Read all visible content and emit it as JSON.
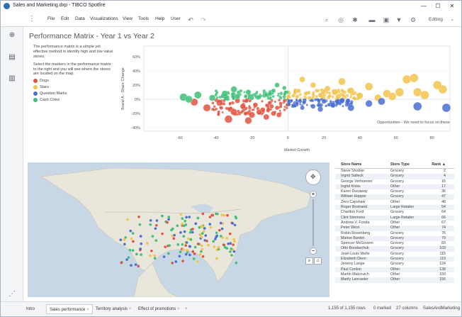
{
  "window": {
    "title": "Sales and Marketing.dxp - TIBCO Spotfire",
    "minimize": "—",
    "maximize": "☐",
    "close": "✕"
  },
  "menu": [
    "File",
    "Edit",
    "Data",
    "Visualizations",
    "View",
    "Tools",
    "Help",
    "User"
  ],
  "mode_label": "Editing",
  "page": {
    "title": "Performance Matrix - Year 1 vs Year 2",
    "description_1": "The performance matrix is a simple yet effective method to identify high and low value stores.",
    "description_2": "Select the markers in the performance matrix to the right and you will see where the stores are located on the map."
  },
  "legend": [
    {
      "label": "Dogs",
      "color": "#e0533f"
    },
    {
      "label": "Stars",
      "color": "#f2c34d"
    },
    {
      "label": "Question Marks",
      "color": "#4a6fd0"
    },
    {
      "label": "Cash Cows",
      "color": "#3fbf77"
    }
  ],
  "chart_data": {
    "type": "scatter",
    "xlabel": "Market Growth",
    "ylabel": "Brand A - Share Change",
    "x_ticks": [
      "-60",
      "-40",
      "-20",
      "0",
      "20",
      "40",
      "60",
      "80"
    ],
    "y_ticks": [
      "60%",
      "40%",
      "20%",
      "0%",
      "-20%",
      "-40%"
    ],
    "xlim": [
      -80,
      90
    ],
    "ylim": [
      -45,
      75
    ],
    "annotation": "Opportunities - We need to focus on these",
    "series": [
      {
        "name": "Dogs",
        "color": "#e0533f",
        "points": [
          [
            -45,
            -12
          ],
          [
            -38,
            -5
          ],
          [
            -30,
            -18
          ],
          [
            -25,
            -10
          ],
          [
            -20,
            -22
          ],
          [
            -18,
            -8
          ],
          [
            -14,
            -15
          ],
          [
            -10,
            -5
          ],
          [
            -8,
            -20
          ],
          [
            -6,
            -12
          ],
          [
            -4,
            -6
          ],
          [
            -2,
            -2
          ],
          [
            -33,
            -28
          ],
          [
            -52,
            -4
          ],
          [
            -22,
            -30
          ],
          [
            -12,
            -25
          ],
          [
            -28,
            -2
          ],
          [
            -16,
            -18
          ],
          [
            -9,
            -10
          ],
          [
            -5,
            -22
          ]
        ]
      },
      {
        "name": "Stars",
        "color": "#f2c34d",
        "points": [
          [
            3,
            5
          ],
          [
            6,
            12
          ],
          [
            10,
            8
          ],
          [
            14,
            20
          ],
          [
            18,
            6
          ],
          [
            22,
            15
          ],
          [
            26,
            10
          ],
          [
            30,
            25
          ],
          [
            35,
            12
          ],
          [
            40,
            5
          ],
          [
            45,
            18
          ],
          [
            55,
            8
          ],
          [
            58,
            4
          ],
          [
            62,
            10
          ],
          [
            66,
            28
          ],
          [
            70,
            30
          ],
          [
            72,
            10
          ],
          [
            76,
            6
          ],
          [
            86,
            14
          ],
          [
            83,
            20
          ],
          [
            8,
            28
          ],
          [
            12,
            2
          ],
          [
            28,
            4
          ],
          [
            50,
            2
          ]
        ]
      },
      {
        "name": "Question Marks",
        "color": "#4a6fd0",
        "points": [
          [
            2,
            -2
          ],
          [
            5,
            -6
          ],
          [
            9,
            -4
          ],
          [
            14,
            -10
          ],
          [
            20,
            -3
          ],
          [
            25,
            -8
          ],
          [
            30,
            -2
          ],
          [
            35,
            -12
          ],
          [
            45,
            -6
          ],
          [
            52,
            -3
          ],
          [
            8,
            -12
          ],
          [
            18,
            -14
          ],
          [
            72,
            -10
          ],
          [
            88,
            -12
          ]
        ]
      },
      {
        "name": "Cash Cows",
        "color": "#3fbf77",
        "points": [
          [
            -50,
            6
          ],
          [
            -42,
            2
          ],
          [
            -35,
            8
          ],
          [
            -28,
            4
          ],
          [
            -22,
            10
          ],
          [
            -16,
            3
          ],
          [
            -12,
            6
          ],
          [
            -8,
            12
          ],
          [
            -4,
            2
          ],
          [
            -2,
            16
          ],
          [
            -58,
            3
          ],
          [
            -30,
            14
          ],
          [
            -20,
            2
          ],
          [
            -10,
            8
          ],
          [
            -6,
            20
          ],
          [
            -55,
            0
          ]
        ]
      }
    ]
  },
  "table": {
    "headers": [
      "Store Name",
      "Store Type",
      "Rank ▲"
    ],
    "rows": [
      [
        "Steve Shobler",
        "Grocery",
        "2"
      ],
      [
        "Ingrid Salleck",
        "Grocery",
        "4"
      ],
      [
        "George Verhoeven",
        "Grocery",
        "15"
      ],
      [
        "Ingrid Kniss",
        "Other",
        "17"
      ],
      [
        "Karen Dunaway",
        "Grocery",
        "36"
      ],
      [
        "William Hopper",
        "Grocery",
        "47"
      ],
      [
        "Zero Capshaw",
        "Other",
        "48"
      ],
      [
        "Roger Bostrand",
        "Large Retailer",
        "54"
      ],
      [
        "Charlton Ford",
        "Grocery",
        "64"
      ],
      [
        "Clint Simmons",
        "Large Retailer",
        "66"
      ],
      [
        "Andrew V. Fonda",
        "Other",
        "67"
      ],
      [
        "Peter West",
        "Other",
        "74"
      ],
      [
        "Robin Rosenberg",
        "Grocery",
        "76"
      ],
      [
        "Marise Bardot",
        "Grocery",
        "79"
      ],
      [
        "Spencer McGovern",
        "Grocery",
        "83"
      ],
      [
        "Otto Bondarchuk",
        "Grocery",
        "103"
      ],
      [
        "Jean-Louis Welle",
        "Grocery",
        "115"
      ],
      [
        "Elizabeth Diem",
        "Grocery",
        "119"
      ],
      [
        "Jeremy Lange",
        "Grocery",
        "124"
      ],
      [
        "Paul Conlon",
        "Other",
        "138"
      ],
      [
        "Martin Malcovich",
        "Other",
        "150"
      ],
      [
        "Marily Lancaster",
        "Other",
        "156"
      ]
    ]
  },
  "tabs": [
    "Intro",
    "Sales performance",
    "Territory analysis",
    "Effect of promotions"
  ],
  "status": {
    "rows": "1,155 of 1,155 rows",
    "marked": "0 marked",
    "columns": "27 columns",
    "name": "SalesAndMarketing"
  }
}
